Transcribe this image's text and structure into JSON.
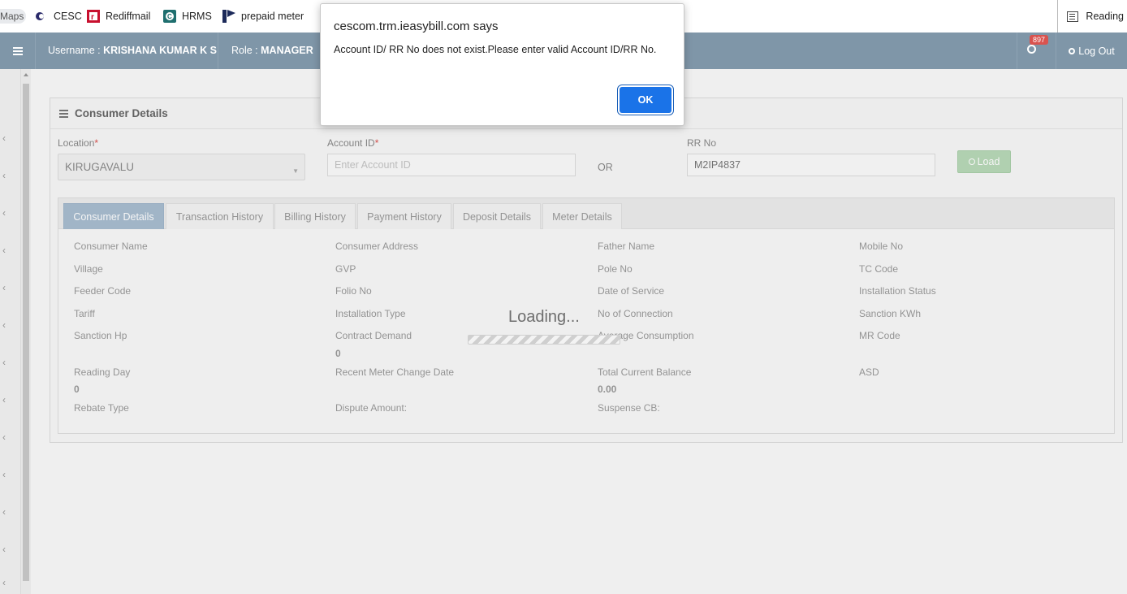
{
  "bookmarks": {
    "items": [
      {
        "label": "Maps",
        "icon": "maps-icon"
      },
      {
        "label": "CESC",
        "icon": "cesc-icon"
      },
      {
        "label": "Rediffmail",
        "icon": "rediffmail-icon"
      },
      {
        "label": "HRMS",
        "icon": "hrms-icon"
      },
      {
        "label": "prepaid meter",
        "icon": "prepaid-meter-icon"
      }
    ],
    "reading_list": "Reading"
  },
  "header": {
    "username_label": "Username : ",
    "username": "KRISHANA KUMAR K S",
    "role_label": "Role : ",
    "role": "MANAGER",
    "notification_count": "897",
    "logout": "Log Out"
  },
  "panel": {
    "title": "Consumer Details",
    "location_label": "Location",
    "location_value": "KIRUGAVALU",
    "account_id_label": "Account ID",
    "account_id_placeholder": "Enter Account ID",
    "or": "OR",
    "rr_no_label": "RR No",
    "rr_no_value": "M2IP4837",
    "load_button": "Load",
    "required_mark": "*"
  },
  "tabs": [
    "Consumer Details",
    "Transaction History",
    "Billing History",
    "Payment History",
    "Deposit Details",
    "Meter Details"
  ],
  "fields": {
    "consumer_name": "Consumer Name",
    "consumer_address": "Consumer Address",
    "father_name": "Father Name",
    "mobile_no": "Mobile No",
    "village": "Village",
    "gvp": "GVP",
    "pole_no": "Pole No",
    "tc_code": "TC Code",
    "feeder_code": "Feeder Code",
    "folio_no": "Folio No",
    "date_of_service": "Date of Service",
    "installation_status": "Installation Status",
    "tariff": "Tariff",
    "installation_type": "Installation Type",
    "no_of_connection": "No of Connection",
    "sanction_kwh": "Sanction KWh",
    "sanction_hp": "Sanction Hp",
    "contract_demand": "Contract Demand",
    "contract_demand_value": "0",
    "average_consumption": "Average Consumption",
    "mr_code": "MR Code",
    "reading_day": "Reading Day",
    "reading_day_value": "0",
    "recent_meter_change_date": "Recent Meter Change Date",
    "total_current_balance": "Total Current Balance",
    "total_current_balance_value": "0.00",
    "asd": "ASD",
    "rebate_type": "Rebate Type",
    "dispute_amount": "Dispute Amount:",
    "suspense_cb": "Suspense CB:"
  },
  "loading": "Loading...",
  "dialog": {
    "title": "cescom.trm.ieasybill.com says",
    "message": "Account ID/ RR No does not exist.Please enter valid Account ID/RR No.",
    "ok": "OK"
  }
}
